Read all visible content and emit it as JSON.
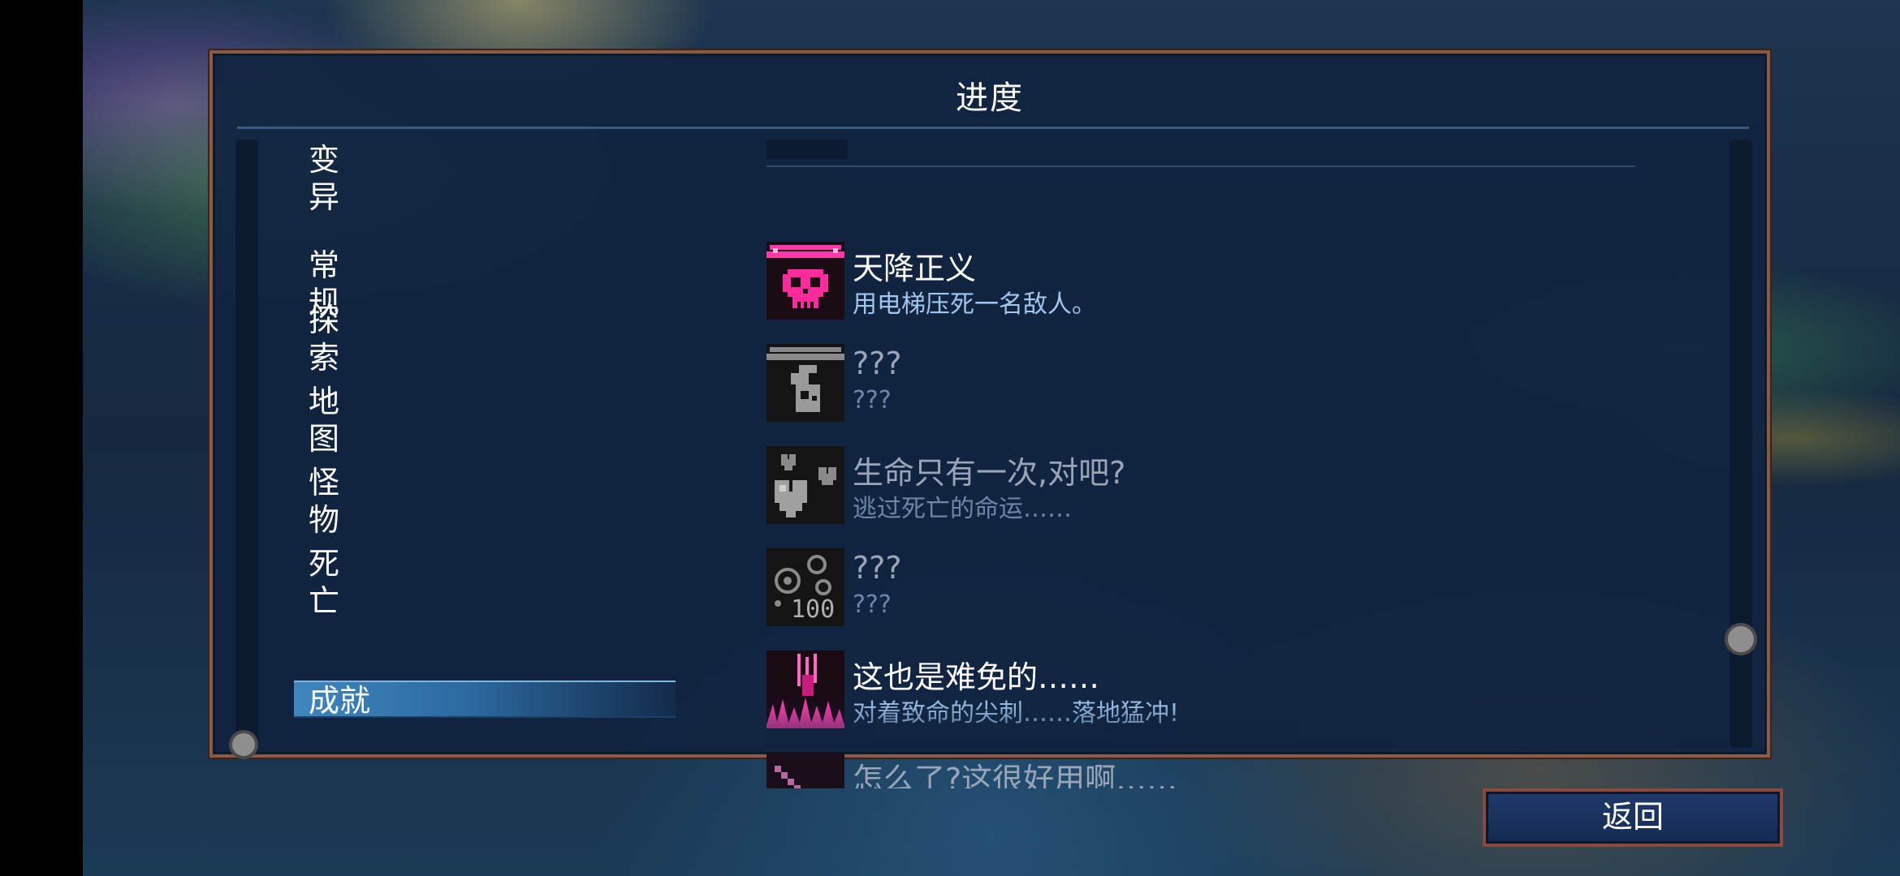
{
  "panel": {
    "title": "进度"
  },
  "categories": [
    {
      "label": "变异",
      "active": false
    },
    {
      "label": "常规",
      "active": false
    },
    {
      "label": "探索",
      "active": false
    },
    {
      "label": "地图",
      "active": false
    },
    {
      "label": "怪物",
      "active": false
    },
    {
      "label": "死亡",
      "active": false
    },
    {
      "label": "成就",
      "active": true
    }
  ],
  "achievements": [
    {
      "name": "天降正义",
      "desc": "用电梯压死一名敌人。",
      "unlocked": true,
      "icon": "skull-elevator-icon"
    },
    {
      "name": "???",
      "desc": "???",
      "unlocked": false,
      "icon": "flask-elevator-icon"
    },
    {
      "name": "生命只有一次,对吧?",
      "desc": "逃过死亡的命运……",
      "unlocked": false,
      "icon": "hearts-icon"
    },
    {
      "name": "???",
      "desc": "???",
      "unlocked": false,
      "icon": "cells-100-icon",
      "icon_text": "100"
    },
    {
      "name": "这也是难免的……",
      "desc": "对着致命的尖刺……落地猛冲!",
      "unlocked": true,
      "icon": "spikes-icon"
    },
    {
      "name": "怎么了?这很好用啊……",
      "desc": "",
      "unlocked": false,
      "icon": "sword-icon"
    }
  ],
  "footer": {
    "back_label": "返回"
  },
  "colors": {
    "panel_bg": "#102440",
    "panel_border": "#8a5a44",
    "accent_pink": "#e0208a",
    "desc_unlocked": "#a3c6ee",
    "desc_locked": "#6f86a8",
    "active_tab": "#3f86bf"
  }
}
